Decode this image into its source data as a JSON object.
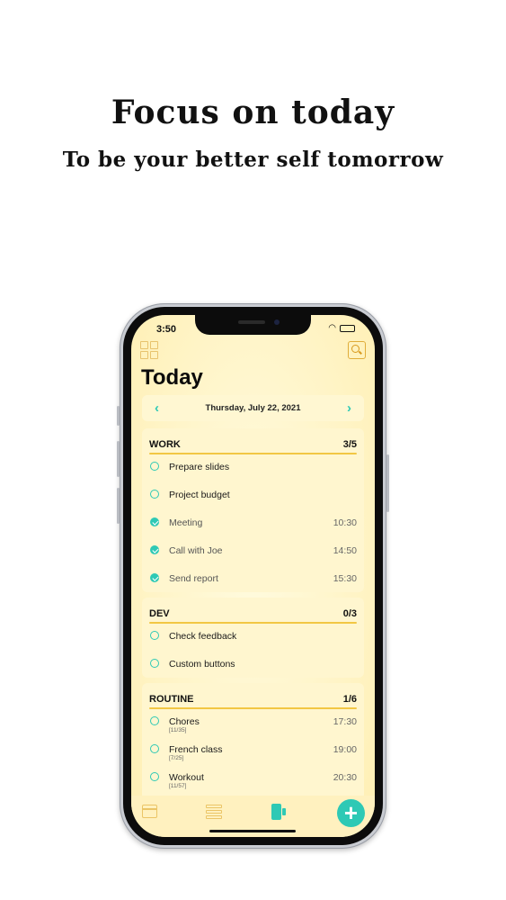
{
  "marketing": {
    "headline": "Focus on today",
    "subheadline": "To be your better self tomorrow"
  },
  "status_bar": {
    "time": "3:50",
    "wifi_icon": "wifi-icon",
    "battery_icon": "battery-icon"
  },
  "header": {
    "title": "Today",
    "left_icon": "grid-icon",
    "right_icon": "search-icon"
  },
  "date_nav": {
    "prev": "‹",
    "label": "Thursday, July 22, 2021",
    "next": "›"
  },
  "sections": [
    {
      "title": "WORK",
      "count": "3/5",
      "tasks": [
        {
          "label": "Prepare slides",
          "time": "",
          "sub": "",
          "done": false
        },
        {
          "label": "Project budget",
          "time": "",
          "sub": "",
          "done": false
        },
        {
          "label": "Meeting",
          "time": "10:30",
          "sub": "",
          "done": true
        },
        {
          "label": "Call with Joe",
          "time": "14:50",
          "sub": "",
          "done": true
        },
        {
          "label": "Send report",
          "time": "15:30",
          "sub": "",
          "done": true
        }
      ]
    },
    {
      "title": "DEV",
      "count": "0/3",
      "tasks": [
        {
          "label": "Check feedback",
          "time": "",
          "sub": "",
          "done": false
        },
        {
          "label": "Custom buttons",
          "time": "",
          "sub": "",
          "done": false
        }
      ]
    },
    {
      "title": "ROUTINE",
      "count": "1/6",
      "tasks": [
        {
          "label": "Chores",
          "time": "17:30",
          "sub": "[11/35]",
          "done": false
        },
        {
          "label": "French class",
          "time": "19:00",
          "sub": "[7/25]",
          "done": false
        },
        {
          "label": "Workout",
          "time": "20:30",
          "sub": "[11/57]",
          "done": false
        }
      ]
    }
  ],
  "tab_bar": {
    "items": [
      "calendar-icon",
      "list-icon",
      "notebook-icon"
    ],
    "add_label": "+"
  },
  "colors": {
    "accent": "#2ec9b5",
    "section_line": "#f2c744",
    "screen_bg": "#fff4c6"
  }
}
